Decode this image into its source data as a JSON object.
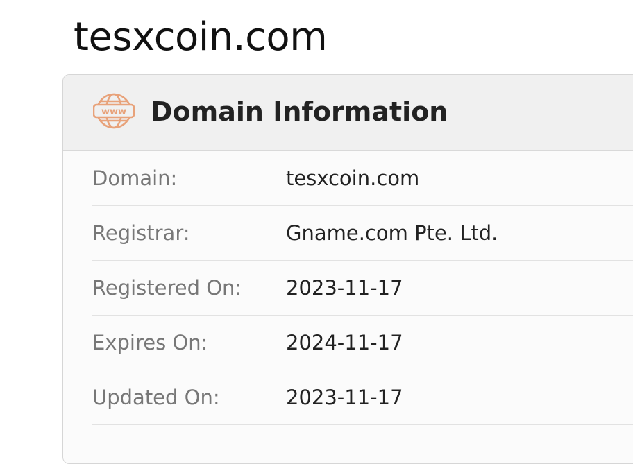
{
  "page": {
    "title": "tesxcoin.com"
  },
  "card": {
    "title": "Domain Information",
    "icon": "www-globe-icon",
    "icon_text": "www",
    "accent_color": "#e8a27a"
  },
  "rows": [
    {
      "label": "Domain:",
      "value": "tesxcoin.com"
    },
    {
      "label": "Registrar:",
      "value": "Gname.com Pte. Ltd."
    },
    {
      "label": "Registered On:",
      "value": "2023-11-17"
    },
    {
      "label": "Expires On:",
      "value": "2024-11-17"
    },
    {
      "label": "Updated On:",
      "value": "2023-11-17"
    }
  ]
}
